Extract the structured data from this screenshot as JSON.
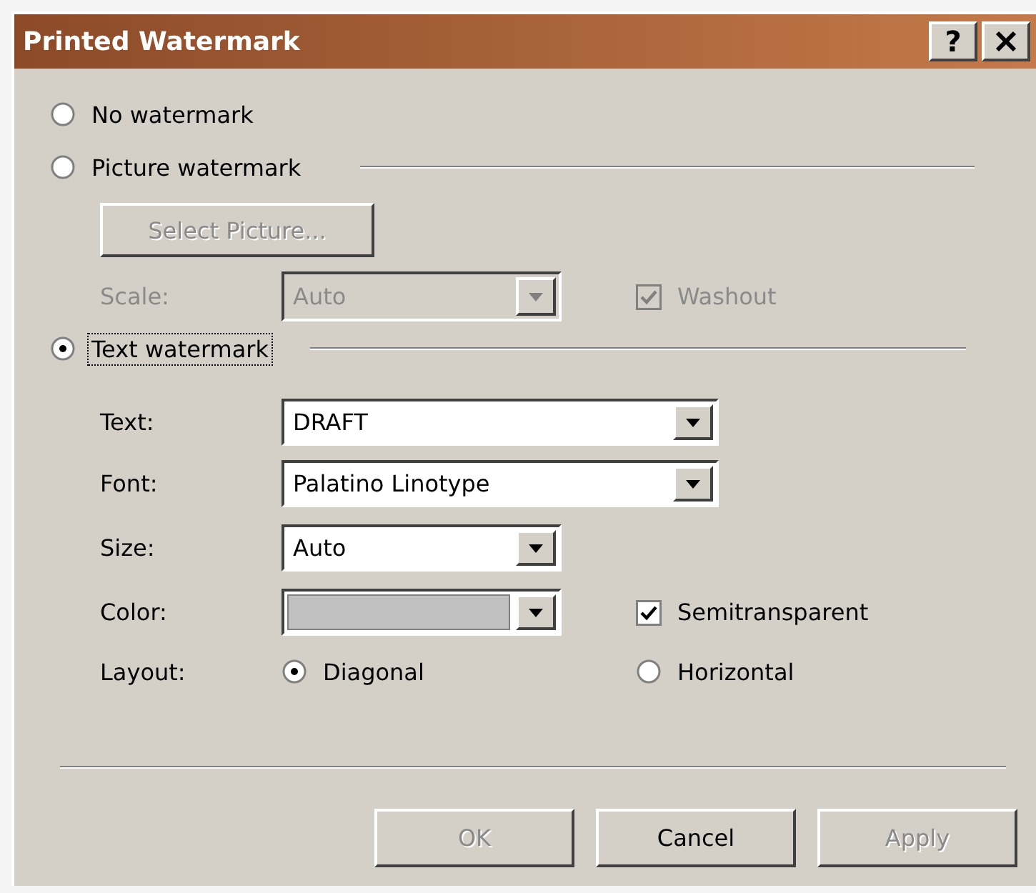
{
  "window": {
    "title": "Printed Watermark",
    "help_button": "?"
  },
  "no_watermark": {
    "label": "No watermark",
    "selected": false
  },
  "picture_watermark": {
    "label": "Picture watermark",
    "selected": false,
    "select_button": {
      "label": "Select Picture...",
      "disabled": true
    },
    "scale": {
      "label": "Scale:",
      "value": "Auto",
      "disabled": true
    },
    "washout": {
      "label": "Washout",
      "checked": true,
      "disabled": true
    }
  },
  "text_watermark": {
    "label": "Text watermark",
    "selected": true,
    "focused": true,
    "fields": [
      {
        "kind": "wide_combo",
        "label": "Text:",
        "value": "DRAFT"
      },
      {
        "kind": "wide_combo",
        "label": "Font:",
        "value": "Palatino Linotype"
      },
      {
        "kind": "narrow_combo",
        "label": "Size:",
        "value": "Auto"
      },
      {
        "kind": "color_combo",
        "label": "Color:",
        "color": "#c0c0c0",
        "option": {
          "label": "Semitransparent",
          "checked": true
        }
      }
    ],
    "layout": {
      "label": "Layout:",
      "options": [
        {
          "label": "Diagonal",
          "selected": true
        },
        {
          "label": "Horizontal",
          "selected": false
        }
      ]
    }
  },
  "buttons": [
    {
      "label": "OK",
      "disabled": true
    },
    {
      "label": "Cancel",
      "disabled": false
    },
    {
      "label": "Apply",
      "disabled": true
    }
  ]
}
